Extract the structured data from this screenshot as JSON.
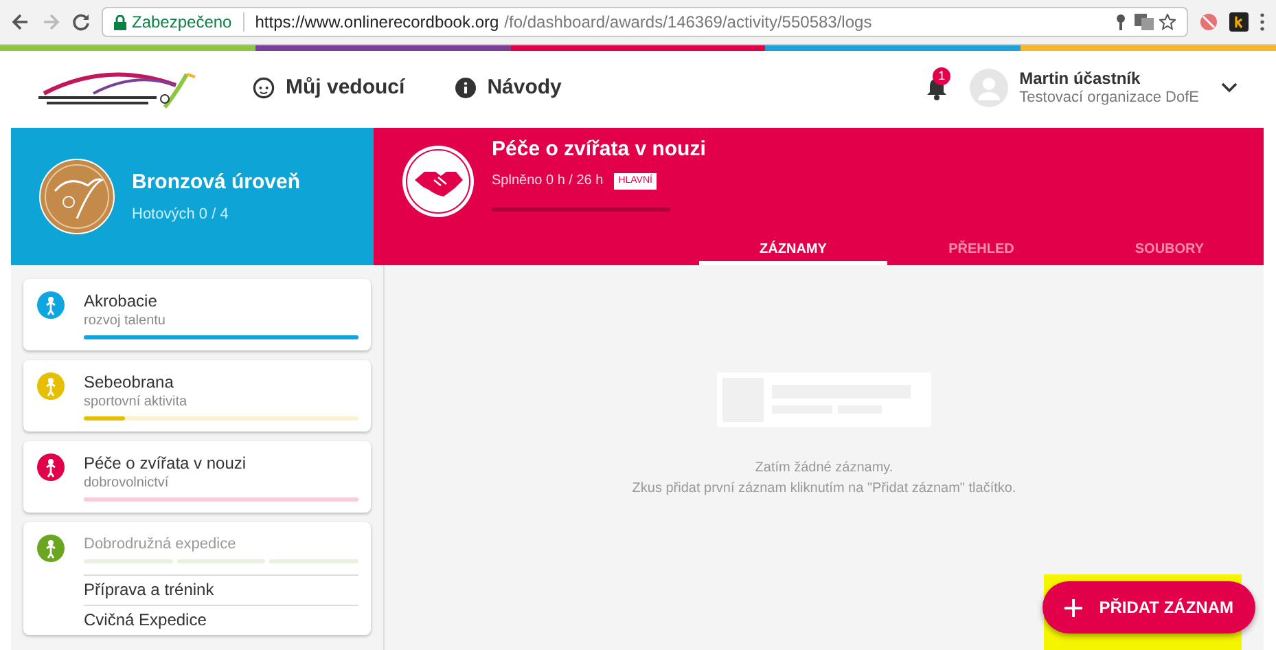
{
  "browser": {
    "security": "Zabezpečeno",
    "url_host": "https://www.onlinerecordbook.org",
    "url_path": "/fo/dashboard/awards/146369/activity/550583/logs"
  },
  "header": {
    "nav": [
      {
        "label": "Můj vedoucí"
      },
      {
        "label": "Návody"
      }
    ],
    "notification_count": "1",
    "user_name": "Martin účastník",
    "user_org": "Testovací organizace DofE"
  },
  "award": {
    "title": "Bronzová úroveň",
    "subtitle": "Hotových 0 / 4"
  },
  "activity": {
    "title": "Péče o zvířata v nouzi",
    "progress": "Splněno 0 h / 26 h",
    "badge": "HLAVNÍ",
    "level": 0
  },
  "tabs": [
    {
      "label": "ZÁZNAMY",
      "selected": true
    },
    {
      "label": "PŘEHLED",
      "selected": false
    },
    {
      "label": "SOUBORY",
      "selected": false
    }
  ],
  "sections": [
    {
      "kind": "single",
      "title": "Akrobacie",
      "subtitle": "rozvoj talentu",
      "color": "#0ea5e0",
      "level": 1
    },
    {
      "kind": "single",
      "title": "Sebeobrana",
      "subtitle": "sportovní aktivita",
      "color": "#e6c000",
      "level": 0.15
    },
    {
      "kind": "single",
      "title": "Péče o zvířata v nouzi",
      "subtitle": "dobrovolnictví",
      "color": "#e2004a",
      "level": 0
    },
    {
      "kind": "expedition",
      "title": "Dobrodružná expedice",
      "color": "#6aa61f",
      "segments": [
        {
          "level": 0
        },
        {
          "level": 0
        },
        {
          "level": 0
        }
      ],
      "items": [
        "Příprava a trénink",
        "Cvičná Expedice"
      ]
    }
  ],
  "empty": {
    "title": "Zatím žádné záznamy.",
    "hint": "Zkus přidat první záznam kliknutím na \"Přidat záznam\" tlačítko."
  },
  "add_button": {
    "label": "PŘIDAT ZÁZNAM",
    "highlighted": true
  }
}
